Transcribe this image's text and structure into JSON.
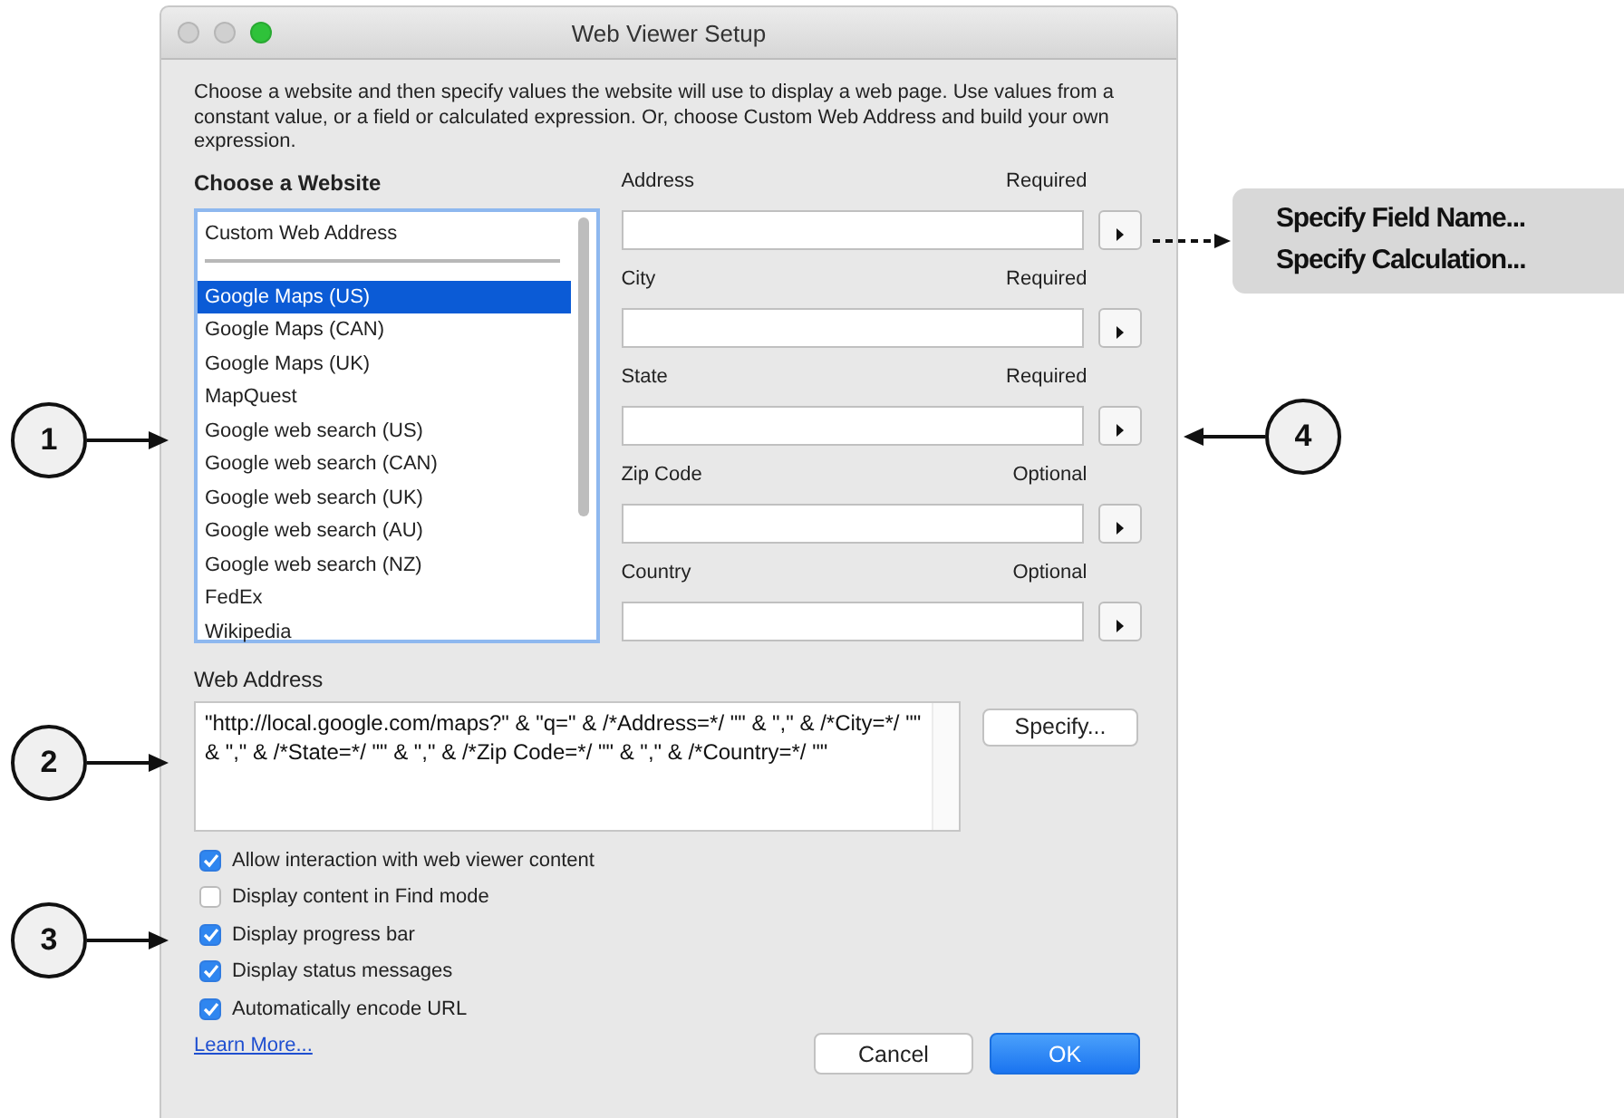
{
  "window": {
    "title": "Web Viewer Setup"
  },
  "description": "Choose a website and then specify values the website will use to display a web page. Use values from a constant value, or a field or calculated expression. Or, choose Custom Web Address and build your own expression.",
  "website_list": {
    "heading": "Choose a Website",
    "pinned": "Custom Web Address",
    "items": [
      {
        "label": "Google Maps (US)",
        "selected": true
      },
      {
        "label": "Google Maps (CAN)",
        "selected": false
      },
      {
        "label": "Google Maps (UK)",
        "selected": false
      },
      {
        "label": "MapQuest",
        "selected": false
      },
      {
        "label": "Google web search (US)",
        "selected": false
      },
      {
        "label": "Google web search (CAN)",
        "selected": false
      },
      {
        "label": "Google web search (UK)",
        "selected": false
      },
      {
        "label": "Google web search (AU)",
        "selected": false
      },
      {
        "label": "Google web search (NZ)",
        "selected": false
      },
      {
        "label": "FedEx",
        "selected": false
      },
      {
        "label": "Wikipedia",
        "selected": false
      }
    ]
  },
  "fields": [
    {
      "label": "Address",
      "requirement": "Required"
    },
    {
      "label": "City",
      "requirement": "Required"
    },
    {
      "label": "State",
      "requirement": "Required"
    },
    {
      "label": "Zip Code",
      "requirement": "Optional"
    },
    {
      "label": "Country",
      "requirement": "Optional"
    }
  ],
  "web_address": {
    "label": "Web Address",
    "value": "\"http://local.google.com/maps?\" & \"q=\" & /*Address=*/ \"\" & \",\" & /*City=*/ \"\" & \",\" & /*State=*/ \"\" & \",\" & /*Zip Code=*/ \"\" & \",\" & /*Country=*/ \"\"",
    "button": "Specify..."
  },
  "options": [
    {
      "label": "Allow interaction with web viewer content",
      "checked": true
    },
    {
      "label": "Display content in Find mode",
      "checked": false
    },
    {
      "label": "Display progress bar",
      "checked": true
    },
    {
      "label": "Display status messages",
      "checked": true
    },
    {
      "label": "Automatically encode URL",
      "checked": true
    }
  ],
  "learn_more": "Learn More...",
  "buttons": [
    {
      "label": "Cancel",
      "primary": false
    },
    {
      "label": "OK",
      "primary": true
    }
  ],
  "menu_callout": [
    "Specify Field Name...",
    "Specify Calculation..."
  ],
  "callouts": [
    "1",
    "2",
    "3",
    "4"
  ]
}
